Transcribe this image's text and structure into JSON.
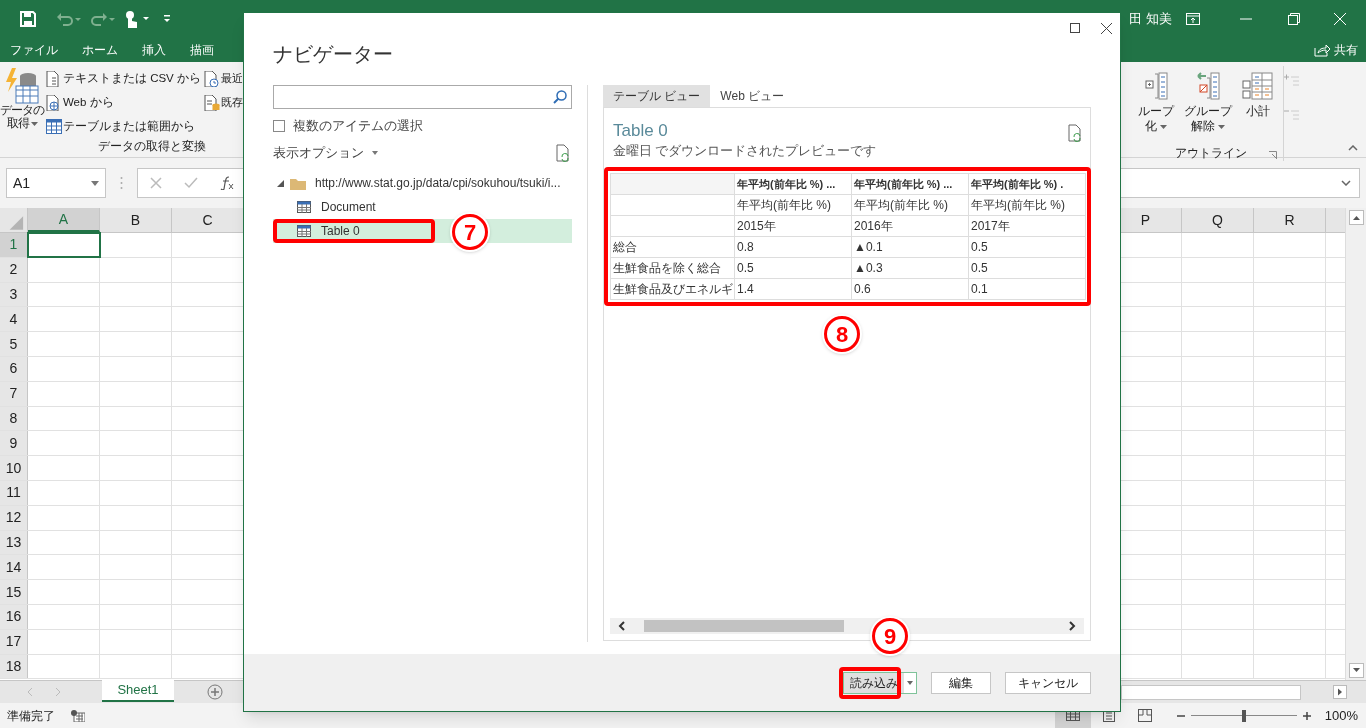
{
  "title_bar": {
    "user": "田 知美"
  },
  "ribbon_tabs": [
    "ファイル",
    "ホーム",
    "挿入",
    "描画"
  ],
  "share": "共有",
  "get_data_group": {
    "big_button": [
      "データの",
      "取得"
    ],
    "label": "データの取得と変換",
    "small_buttons": [
      {
        "kind": "text-file",
        "label": "テキストまたは CSV から"
      },
      {
        "kind": "web",
        "label": "Web から"
      },
      {
        "kind": "table",
        "label": "テーブルまたは範囲から"
      }
    ],
    "more_buttons": [
      {
        "kind": "recent",
        "label": "最近"
      },
      {
        "kind": "existing",
        "label": "既存"
      }
    ]
  },
  "outline_group": {
    "label": "アウトライン",
    "buttons": [
      {
        "kind": "group",
        "lines": [
          "ループ",
          "化"
        ],
        "dropdown": true
      },
      {
        "kind": "ungroup",
        "lines": [
          "グループ",
          "解除"
        ],
        "dropdown": true
      },
      {
        "kind": "subtotal",
        "lines": [
          "小計"
        ],
        "dropdown": false
      }
    ]
  },
  "formula_bar": {
    "name_box": "A1"
  },
  "grid": {
    "left_columns": [
      {
        "label": "A",
        "selected": true
      },
      {
        "label": "B",
        "selected": false
      },
      {
        "label": "C",
        "selected": false
      }
    ],
    "right_columns": [
      {
        "label": "P",
        "selected": false
      },
      {
        "label": "Q",
        "selected": false
      },
      {
        "label": "R",
        "selected": false
      }
    ],
    "rows": [
      {
        "label": "1",
        "selected": true
      },
      {
        "label": "2",
        "selected": false
      },
      {
        "label": "3",
        "selected": false
      },
      {
        "label": "4",
        "selected": false
      },
      {
        "label": "5",
        "selected": false
      },
      {
        "label": "6",
        "selected": false
      },
      {
        "label": "7",
        "selected": false
      },
      {
        "label": "8",
        "selected": false
      },
      {
        "label": "9",
        "selected": false
      },
      {
        "label": "10",
        "selected": false
      },
      {
        "label": "11",
        "selected": false
      },
      {
        "label": "12",
        "selected": false
      },
      {
        "label": "13",
        "selected": false
      },
      {
        "label": "14",
        "selected": false
      },
      {
        "label": "15",
        "selected": false
      },
      {
        "label": "16",
        "selected": false
      },
      {
        "label": "17",
        "selected": false
      },
      {
        "label": "18",
        "selected": false
      }
    ]
  },
  "sheet_tabs": [
    {
      "label": "Sheet1",
      "selected": true
    }
  ],
  "status_bar": {
    "status": "準備完了",
    "zoom": "100%",
    "zoom_slider": {
      "level": 0.5
    },
    "views": [
      {
        "kind": "normal",
        "selected": true
      },
      {
        "kind": "page-layout",
        "selected": false
      },
      {
        "kind": "page-break",
        "selected": false
      }
    ]
  },
  "dialog": {
    "title": "ナビゲーター",
    "multi_select": {
      "label": "複数のアイテムの選択",
      "checked": false
    },
    "display_options": "表示オプション",
    "tree": [
      {
        "label": "http://www.stat.go.jp/data/cpi/sokuhou/tsuki/i...",
        "kind": "folder",
        "expanded": true,
        "selected": false,
        "children": [
          {
            "label": "Document",
            "kind": "table",
            "selected": false
          },
          {
            "label": "Table 0",
            "kind": "table",
            "selected": true
          }
        ]
      }
    ],
    "view_tabs": [
      {
        "label": "テーブル ビュー",
        "selected": true
      },
      {
        "label": "Web ビュー",
        "selected": false
      }
    ],
    "preview": {
      "title": "Table 0",
      "subtitle": "金曜日 でダウンロードされたプレビューです",
      "columns": [
        "年平均(前年比 %) ...",
        "年平均(前年比 %) ...",
        "年平均(前年比 %) ."
      ],
      "rows": [
        {
          "cells": [
            "年平均(前年比 %)",
            "年平均(前年比 %)",
            "年平均(前年比 %)"
          ]
        },
        {
          "cells": [
            "2015年",
            "2016年",
            "2017年"
          ]
        },
        {
          "label": "総合",
          "cells": [
            "0.8",
            "▲0.1",
            "0.5"
          ]
        },
        {
          "label": "生鮮食品を除く総合",
          "cells": [
            "0.5",
            "▲0.3",
            "0.5"
          ]
        },
        {
          "label": "生鮮食品及びエネルギ",
          "cells": [
            "1.4",
            "0.6",
            "0.1"
          ]
        }
      ]
    },
    "buttons": [
      {
        "kind": "load",
        "label": "読み込み",
        "split": true
      },
      {
        "kind": "edit",
        "label": "編集",
        "split": false
      },
      {
        "kind": "cancel",
        "label": "キャンセル",
        "split": false
      }
    ]
  },
  "annotations": [
    {
      "number": "7"
    },
    {
      "number": "8"
    },
    {
      "number": "9"
    }
  ]
}
